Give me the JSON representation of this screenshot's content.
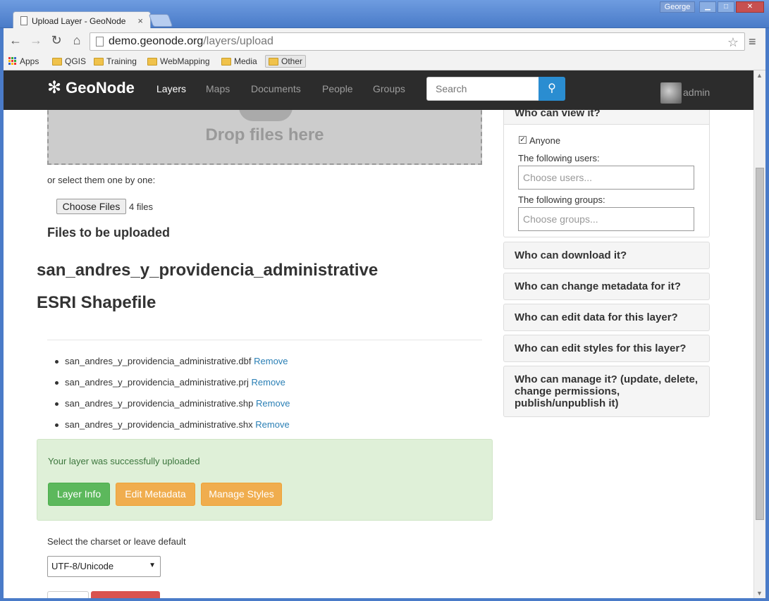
{
  "browser": {
    "tab_title": "Upload Layer - GeoNode",
    "tab_close": "×",
    "user_badge": "George",
    "url_host": "demo.geonode.org",
    "url_path": "/layers/upload",
    "bookmarks": [
      "Apps",
      "QGIS",
      "Training",
      "WebMapping",
      "Media",
      "Other"
    ]
  },
  "site": {
    "brand": "GeoNode",
    "nav": [
      "Layers",
      "Maps",
      "Documents",
      "People",
      "Groups"
    ],
    "search_placeholder": "Search",
    "user": "admin"
  },
  "upload": {
    "drop_text": "Drop files here",
    "select_text": "or select them one by one:",
    "choose_button": "Choose Files",
    "files_count": "4 files",
    "files_heading": "Files to be uploaded",
    "layer_name": "san_andres_y_providencia_administrative",
    "layer_type": "ESRI Shapefile",
    "files": [
      {
        "name": "san_andres_y_providencia_administrative.dbf",
        "action": "Remove"
      },
      {
        "name": "san_andres_y_providencia_administrative.prj",
        "action": "Remove"
      },
      {
        "name": "san_andres_y_providencia_administrative.shp",
        "action": "Remove"
      },
      {
        "name": "san_andres_y_providencia_administrative.shx",
        "action": "Remove"
      }
    ],
    "success_text": "Your layer was successfully uploaded",
    "btn_layer_info": "Layer Info",
    "btn_edit_metadata": "Edit Metadata",
    "btn_manage_styles": "Manage Styles",
    "charset_label": "Select the charset or leave default",
    "charset_value": "UTF-8/Unicode"
  },
  "permissions": {
    "view_title": "Who can view it?",
    "anyone_label": "Anyone",
    "anyone_checked": true,
    "users_label": "The following users:",
    "users_placeholder": "Choose users...",
    "groups_label": "The following groups:",
    "groups_placeholder": "Choose groups...",
    "download": "Who can download it?",
    "change_metadata": "Who can change metadata for it?",
    "edit_data": "Who can edit data for this layer?",
    "edit_styles": "Who can edit styles for this layer?",
    "manage": "Who can manage it? (update, delete, change permissions, publish/unpublish it)"
  },
  "colors": {
    "navbar": "#2c2c2c",
    "search_button": "#2a8dd1",
    "success_bg": "#dff0d8",
    "btn_green": "#5cb85c",
    "btn_orange": "#f0ad4e",
    "link": "#2a7fb5"
  }
}
